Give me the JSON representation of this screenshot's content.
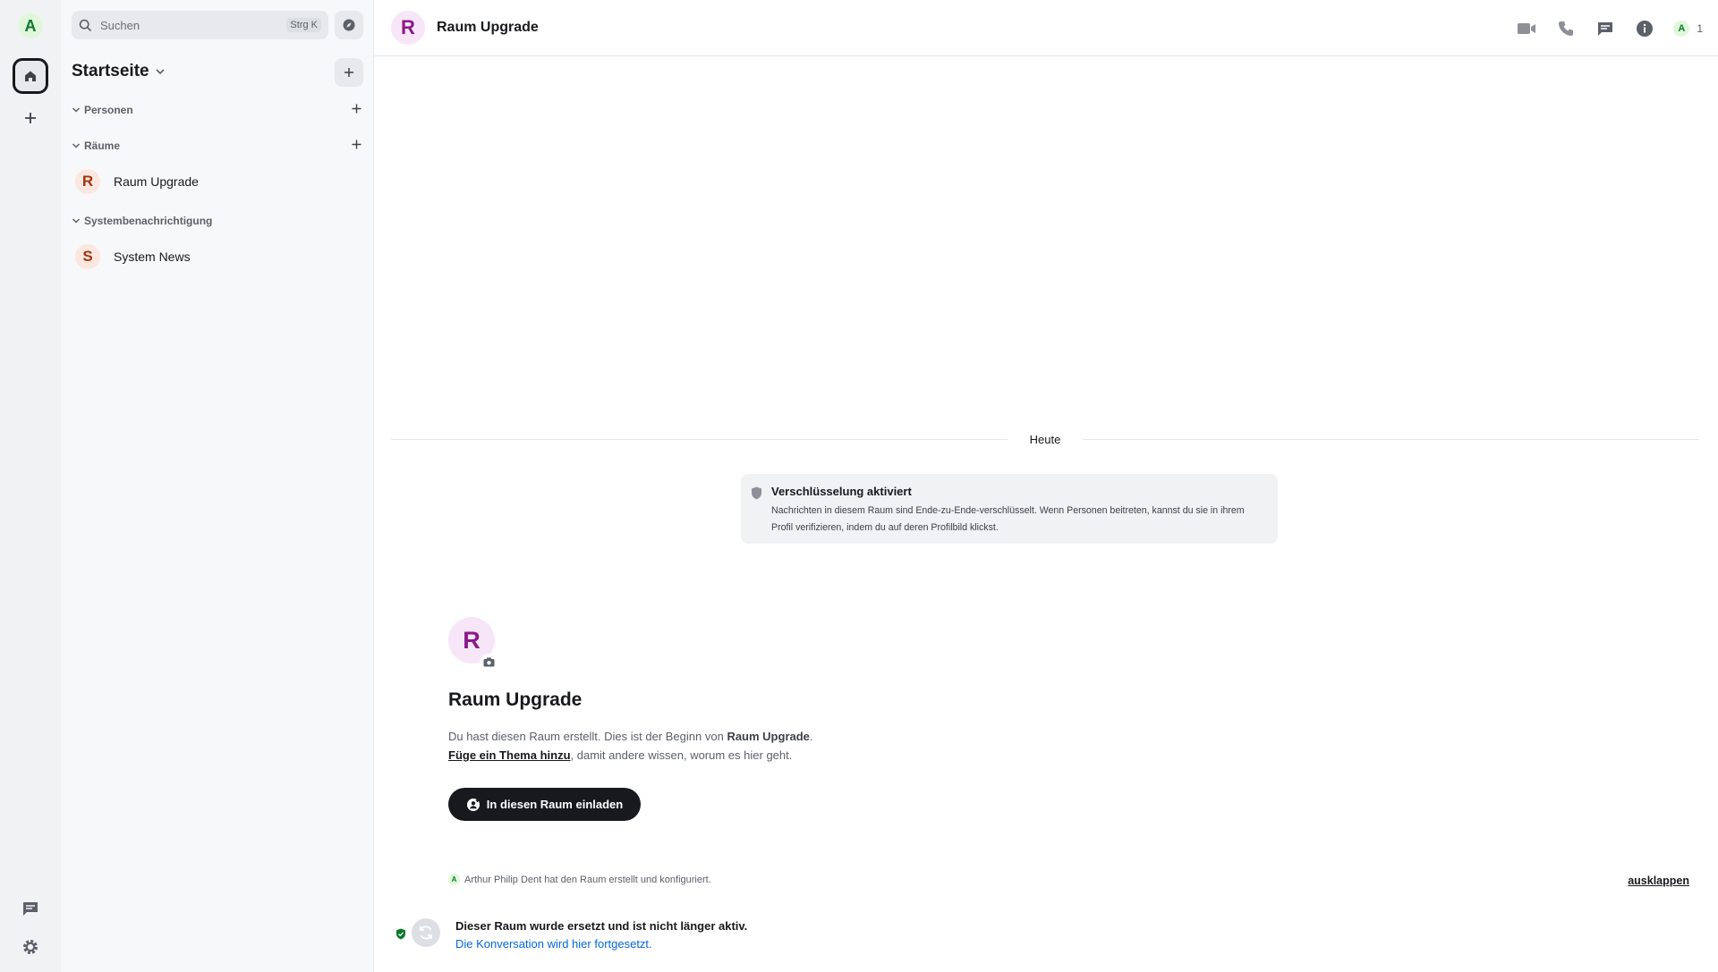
{
  "user": {
    "initial": "A"
  },
  "search": {
    "placeholder": "Suchen",
    "shortcut": "Strg K"
  },
  "home": {
    "title": "Startseite"
  },
  "sections": {
    "people": {
      "label": "Personen"
    },
    "rooms": {
      "label": "Räume"
    },
    "system": {
      "label": "Systembenachrichtigung"
    }
  },
  "rooms": [
    {
      "initial": "R",
      "name": "Raum Upgrade",
      "avatar_bg": "#fbe7e0",
      "avatar_fg": "#a3340f"
    },
    {
      "initial": "S",
      "name": "System News",
      "avatar_bg": "#fbe7e0",
      "avatar_fg": "#a3340f"
    }
  ],
  "header": {
    "avatar_initial": "R",
    "title": "Raum Upgrade",
    "member_initial": "A",
    "member_count": "1"
  },
  "timeline": {
    "date_separator": "Heute",
    "encryption": {
      "title": "Verschlüsselung aktiviert",
      "description": "Nachrichten in diesem Raum sind Ende-zu-Ende-verschlüsselt. Wenn Personen beitreten, kannst du sie in ihrem Profil verifizieren, indem du auf deren Profilbild klickst."
    },
    "new_room": {
      "avatar_initial": "R",
      "title": "Raum Upgrade",
      "desc_prefix": "Du hast diesen Raum erstellt. Dies ist der Beginn von ",
      "desc_room": "Raum Upgrade",
      "desc_suffix": ".",
      "topic_link": "Füge ein Thema hinzu",
      "topic_suffix": ", damit andere wissen, worum es hier geht.",
      "invite_button": "In diesen Raum einladen"
    },
    "summary": {
      "avatar_initial": "A",
      "text": "Arthur Philip Dent hat den Raum erstellt und konfiguriert.",
      "expand": "ausklappen"
    },
    "tombstone": {
      "title": "Dieser Raum wurde ersetzt und ist nicht länger aktiv.",
      "link": "Die Konversation wird hier fortgesetzt."
    }
  },
  "colors": {
    "accent": "#0467dd",
    "room_avatar_purple": "#8b1a8b",
    "verified_green": "#0b7a2e"
  }
}
